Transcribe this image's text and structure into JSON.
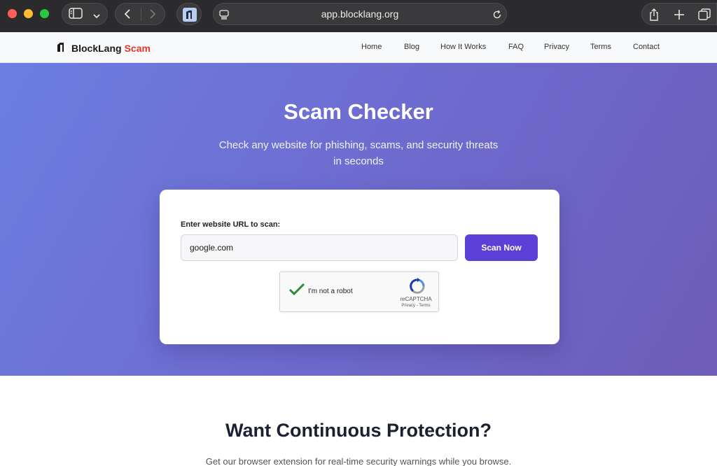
{
  "browser": {
    "url": "app.blocklang.org"
  },
  "site": {
    "brand": "BlockLang",
    "brand_accent": "Scam",
    "nav": [
      "Home",
      "Blog",
      "How It Works",
      "FAQ",
      "Privacy",
      "Terms",
      "Contact"
    ]
  },
  "hero": {
    "title": "Scam Checker",
    "subtitle": "Check any website for phishing, scams, and security threats in seconds"
  },
  "scan_form": {
    "label": "Enter website URL to scan:",
    "input_value": "google.com",
    "button_label": "Scan Now"
  },
  "captcha": {
    "label": "I'm not a robot",
    "brand": "reCAPTCHA",
    "links": "Privacy - Terms"
  },
  "promo": {
    "title": "Want Continuous Protection?",
    "subtitle": "Get our browser extension for real-time security warnings while you browse."
  },
  "colors": {
    "accent": "#5b3fd6",
    "brand_red": "#e0352b",
    "hero_start": "#6c7ee0",
    "hero_end": "#6e5cb8"
  },
  "icons": [
    "sidebar-icon",
    "chevron-down-icon",
    "back-icon",
    "forward-icon",
    "site-favicon-icon",
    "reader-icon",
    "reload-icon",
    "share-icon",
    "new-tab-icon",
    "tabs-overview-icon",
    "checkmark-icon",
    "recaptcha-icon"
  ]
}
